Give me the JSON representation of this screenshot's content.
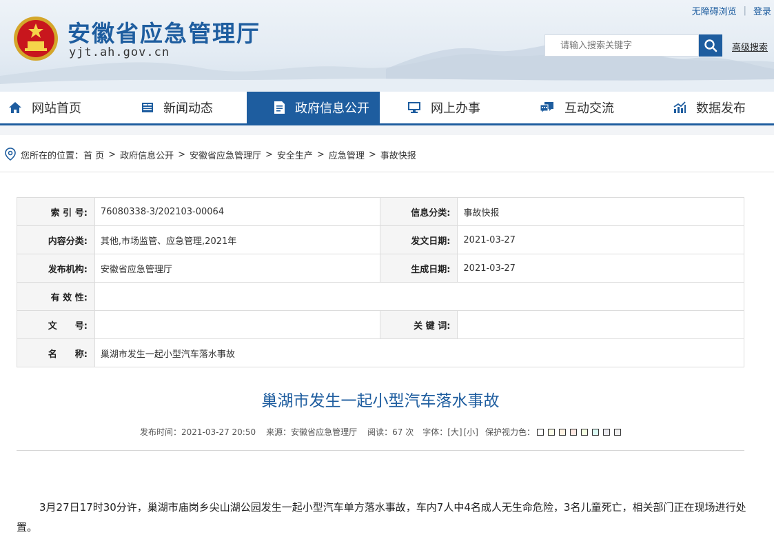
{
  "header": {
    "site_title": "安徽省应急管理厅",
    "site_domain": "yjt.ah.gov.cn",
    "accessibility_link": "无障碍浏览",
    "login_link": "登录",
    "search_placeholder": "请输入搜索关键字",
    "advanced_search": "高级搜索"
  },
  "nav": {
    "items": [
      {
        "label": "网站首页",
        "icon": "home-icon"
      },
      {
        "label": "新闻动态",
        "icon": "news-icon"
      },
      {
        "label": "政府信息公开",
        "icon": "document-icon",
        "active": true
      },
      {
        "label": "网上办事",
        "icon": "monitor-icon"
      },
      {
        "label": "互动交流",
        "icon": "chat-icon"
      },
      {
        "label": "数据发布",
        "icon": "chart-icon"
      }
    ],
    "accent": "#1e5d9f"
  },
  "breadcrumb": {
    "prefix": "您所在的位置：",
    "items": [
      "首 页",
      "政府信息公开",
      "安徽省应急管理厅",
      "安全生产",
      "应急管理",
      "事故快报"
    ]
  },
  "meta": {
    "index_label": "索 引 号:",
    "index_value": "76080338-3/202103-00064",
    "info_cat_label": "信息分类:",
    "info_cat_value": "事故快报",
    "content_cat_label": "内容分类:",
    "content_cat_value": "其他,市场监管、应急管理,2021年",
    "issue_date_label": "发文日期:",
    "issue_date_value": "2021-03-27",
    "publisher_label": "发布机构:",
    "publisher_value": "安徽省应急管理厅",
    "gen_date_label": "生成日期:",
    "gen_date_value": "2021-03-27",
    "validity_label": "有 效 性:",
    "validity_value": "",
    "doc_no_label": "文　　号:",
    "doc_no_value": "",
    "keywords_label": "关 键 词:",
    "keywords_value": "",
    "name_label": "名　　称:",
    "name_value": "巢湖市发生一起小型汽车落水事故"
  },
  "article": {
    "title": "巢湖市发生一起小型汽车落水事故",
    "publish_time": "发布时间：2021-03-27 20:50",
    "source": "来源：安徽省应急管理厅",
    "reads": "阅读：67 次",
    "font_label": "字体：",
    "font_large": "[大]",
    "font_small": "[小]",
    "eye_label": "保护视力色：",
    "swatch_colors": [
      "#ffffff",
      "#fafbe6",
      "#fff2e2",
      "#fde6e0",
      "#f3ffe1",
      "#dafaf3",
      "#eaeaef",
      "#f0f0f0"
    ],
    "body": "3月27日17时30分许，巢湖市庙岗乡尖山湖公园发生一起小型汽车单方落水事故，车内7人中4名成人无生命危险，3名儿童死亡，相关部门正在现场进行处置。"
  }
}
